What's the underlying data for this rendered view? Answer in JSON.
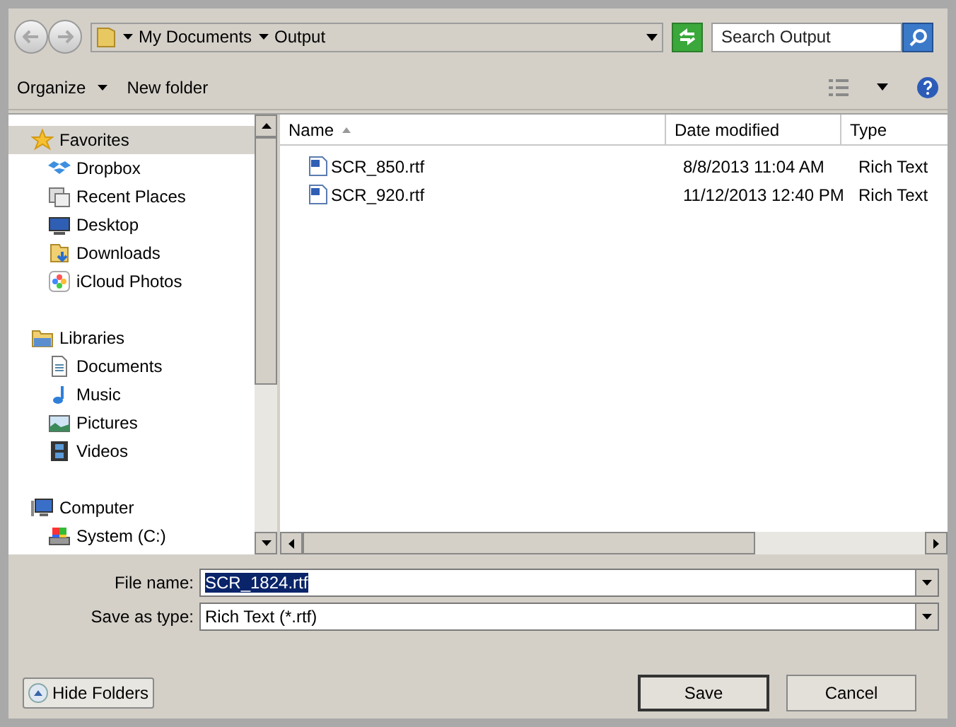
{
  "address": {
    "segments": [
      "My Documents",
      "Output"
    ]
  },
  "search": {
    "placeholder": "Search Output"
  },
  "toolbar": {
    "items": [
      {
        "label": "Organize",
        "kind": "menu"
      },
      {
        "label": "New folder",
        "kind": "plain"
      }
    ]
  },
  "navigation": [
    {
      "label": "Favorites",
      "selected": true,
      "children": [
        {
          "label": "Dropbox",
          "selected": false
        },
        {
          "label": "Recent Places",
          "selected": false
        },
        {
          "label": "Desktop",
          "selected": false
        },
        {
          "label": "Downloads",
          "selected": false
        },
        {
          "label": "iCloud Photos",
          "selected": false
        }
      ]
    },
    {
      "label": "Libraries",
      "selected": false,
      "children": [
        {
          "label": "Documents",
          "selected": false
        },
        {
          "label": "Music",
          "selected": false
        },
        {
          "label": "Pictures",
          "selected": false
        },
        {
          "label": "Videos",
          "selected": false
        }
      ]
    },
    {
      "label": "Computer",
      "selected": false,
      "children": [
        {
          "label": "System (C:)",
          "selected": false
        }
      ]
    }
  ],
  "file_list": {
    "columns": [
      {
        "label": "Name",
        "sorted": true
      },
      {
        "label": "Date modified",
        "sorted": false
      },
      {
        "label": "Type",
        "sorted": false
      }
    ],
    "rows": [
      {
        "name": "SCR_850.rtf",
        "date": "8/8/2013 11:04 AM",
        "type": "Rich Text"
      },
      {
        "name": "SCR_920.rtf",
        "date": "11/12/2013 12:40 PM",
        "type": "Rich Text"
      }
    ]
  },
  "file_name": {
    "label": "File name:",
    "value": "SCR_1824.rtf",
    "text_selected": true
  },
  "save_as_type": {
    "label": "Save as type:",
    "value": "Rich Text (*.rtf)"
  },
  "buttons": {
    "hide_folders": "Hide Folders",
    "save": "Save",
    "cancel": "Cancel"
  }
}
